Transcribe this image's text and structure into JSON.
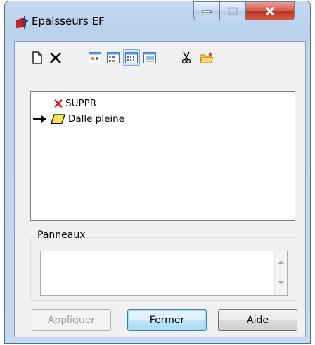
{
  "window": {
    "title": "Epaisseurs EF"
  },
  "title_controls": {
    "minimize_icon": "minimize-icon",
    "maximize_icon": "maximize-icon",
    "close_icon": "close-icon"
  },
  "toolbar": {
    "items": [
      {
        "icon": "new-document-icon"
      },
      {
        "icon": "delete-x-icon"
      },
      {
        "icon": "view-large-icons-icon"
      },
      {
        "icon": "view-small-icons-icon"
      },
      {
        "icon": "view-list-icon",
        "active": true
      },
      {
        "icon": "view-details-icon"
      },
      {
        "icon": "cut-scissors-icon"
      },
      {
        "icon": "open-folder-icon"
      }
    ]
  },
  "tree": {
    "items": [
      {
        "label": "SUPPR",
        "icon": "red-x-icon",
        "current": false
      },
      {
        "label": "Dalle pleine",
        "icon": "slab-icon",
        "current": true
      }
    ]
  },
  "panneaux": {
    "title": "Panneaux",
    "value": ""
  },
  "buttons": {
    "apply": "Appliquer",
    "close": "Fermer",
    "help": "Aide"
  },
  "colors": {
    "accent": "#3c7fb1",
    "close_red": "#c94634",
    "window_frame": "#bed5ee"
  }
}
